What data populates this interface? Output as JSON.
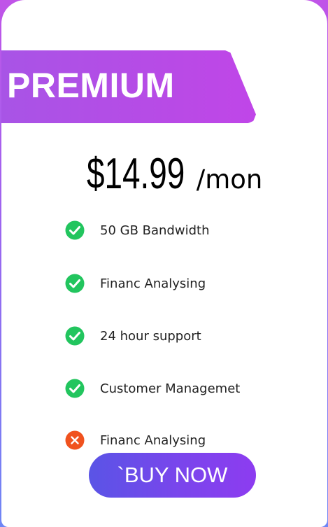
{
  "plan": {
    "name": "PREMIUM",
    "price": "$14.99",
    "period": "/mon"
  },
  "features": [
    {
      "label": "50 GB Bandwidth",
      "included": true,
      "icon": "check-circle-icon"
    },
    {
      "label": "Financ Analysing",
      "included": true,
      "icon": "check-circle-icon"
    },
    {
      "label": "24 hour support",
      "included": true,
      "icon": "check-circle-icon"
    },
    {
      "label": "Customer Managemet",
      "included": true,
      "icon": "check-circle-icon"
    },
    {
      "label": "Financ Analysing",
      "included": false,
      "icon": "x-circle-icon"
    }
  ],
  "cta": {
    "label": "`BUY NOW"
  },
  "colors": {
    "accent_purple": "#b14fe6",
    "button_start": "#5a54e6",
    "button_end": "#8d3cf0",
    "check_green": "#22c55e",
    "cross_orange": "#f0521e",
    "card_background": "#ffffff"
  }
}
